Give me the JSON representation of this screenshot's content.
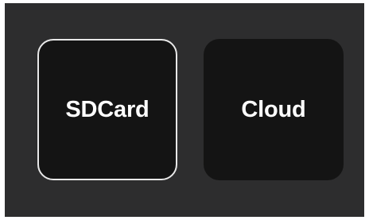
{
  "storage_options": [
    {
      "label": "SDCard",
      "selected": true
    },
    {
      "label": "Cloud",
      "selected": false
    }
  ],
  "colors": {
    "background": "#2d2d2e",
    "tile": "#141414",
    "selected_border": "#e8e8e8",
    "label": "#ffffff"
  }
}
